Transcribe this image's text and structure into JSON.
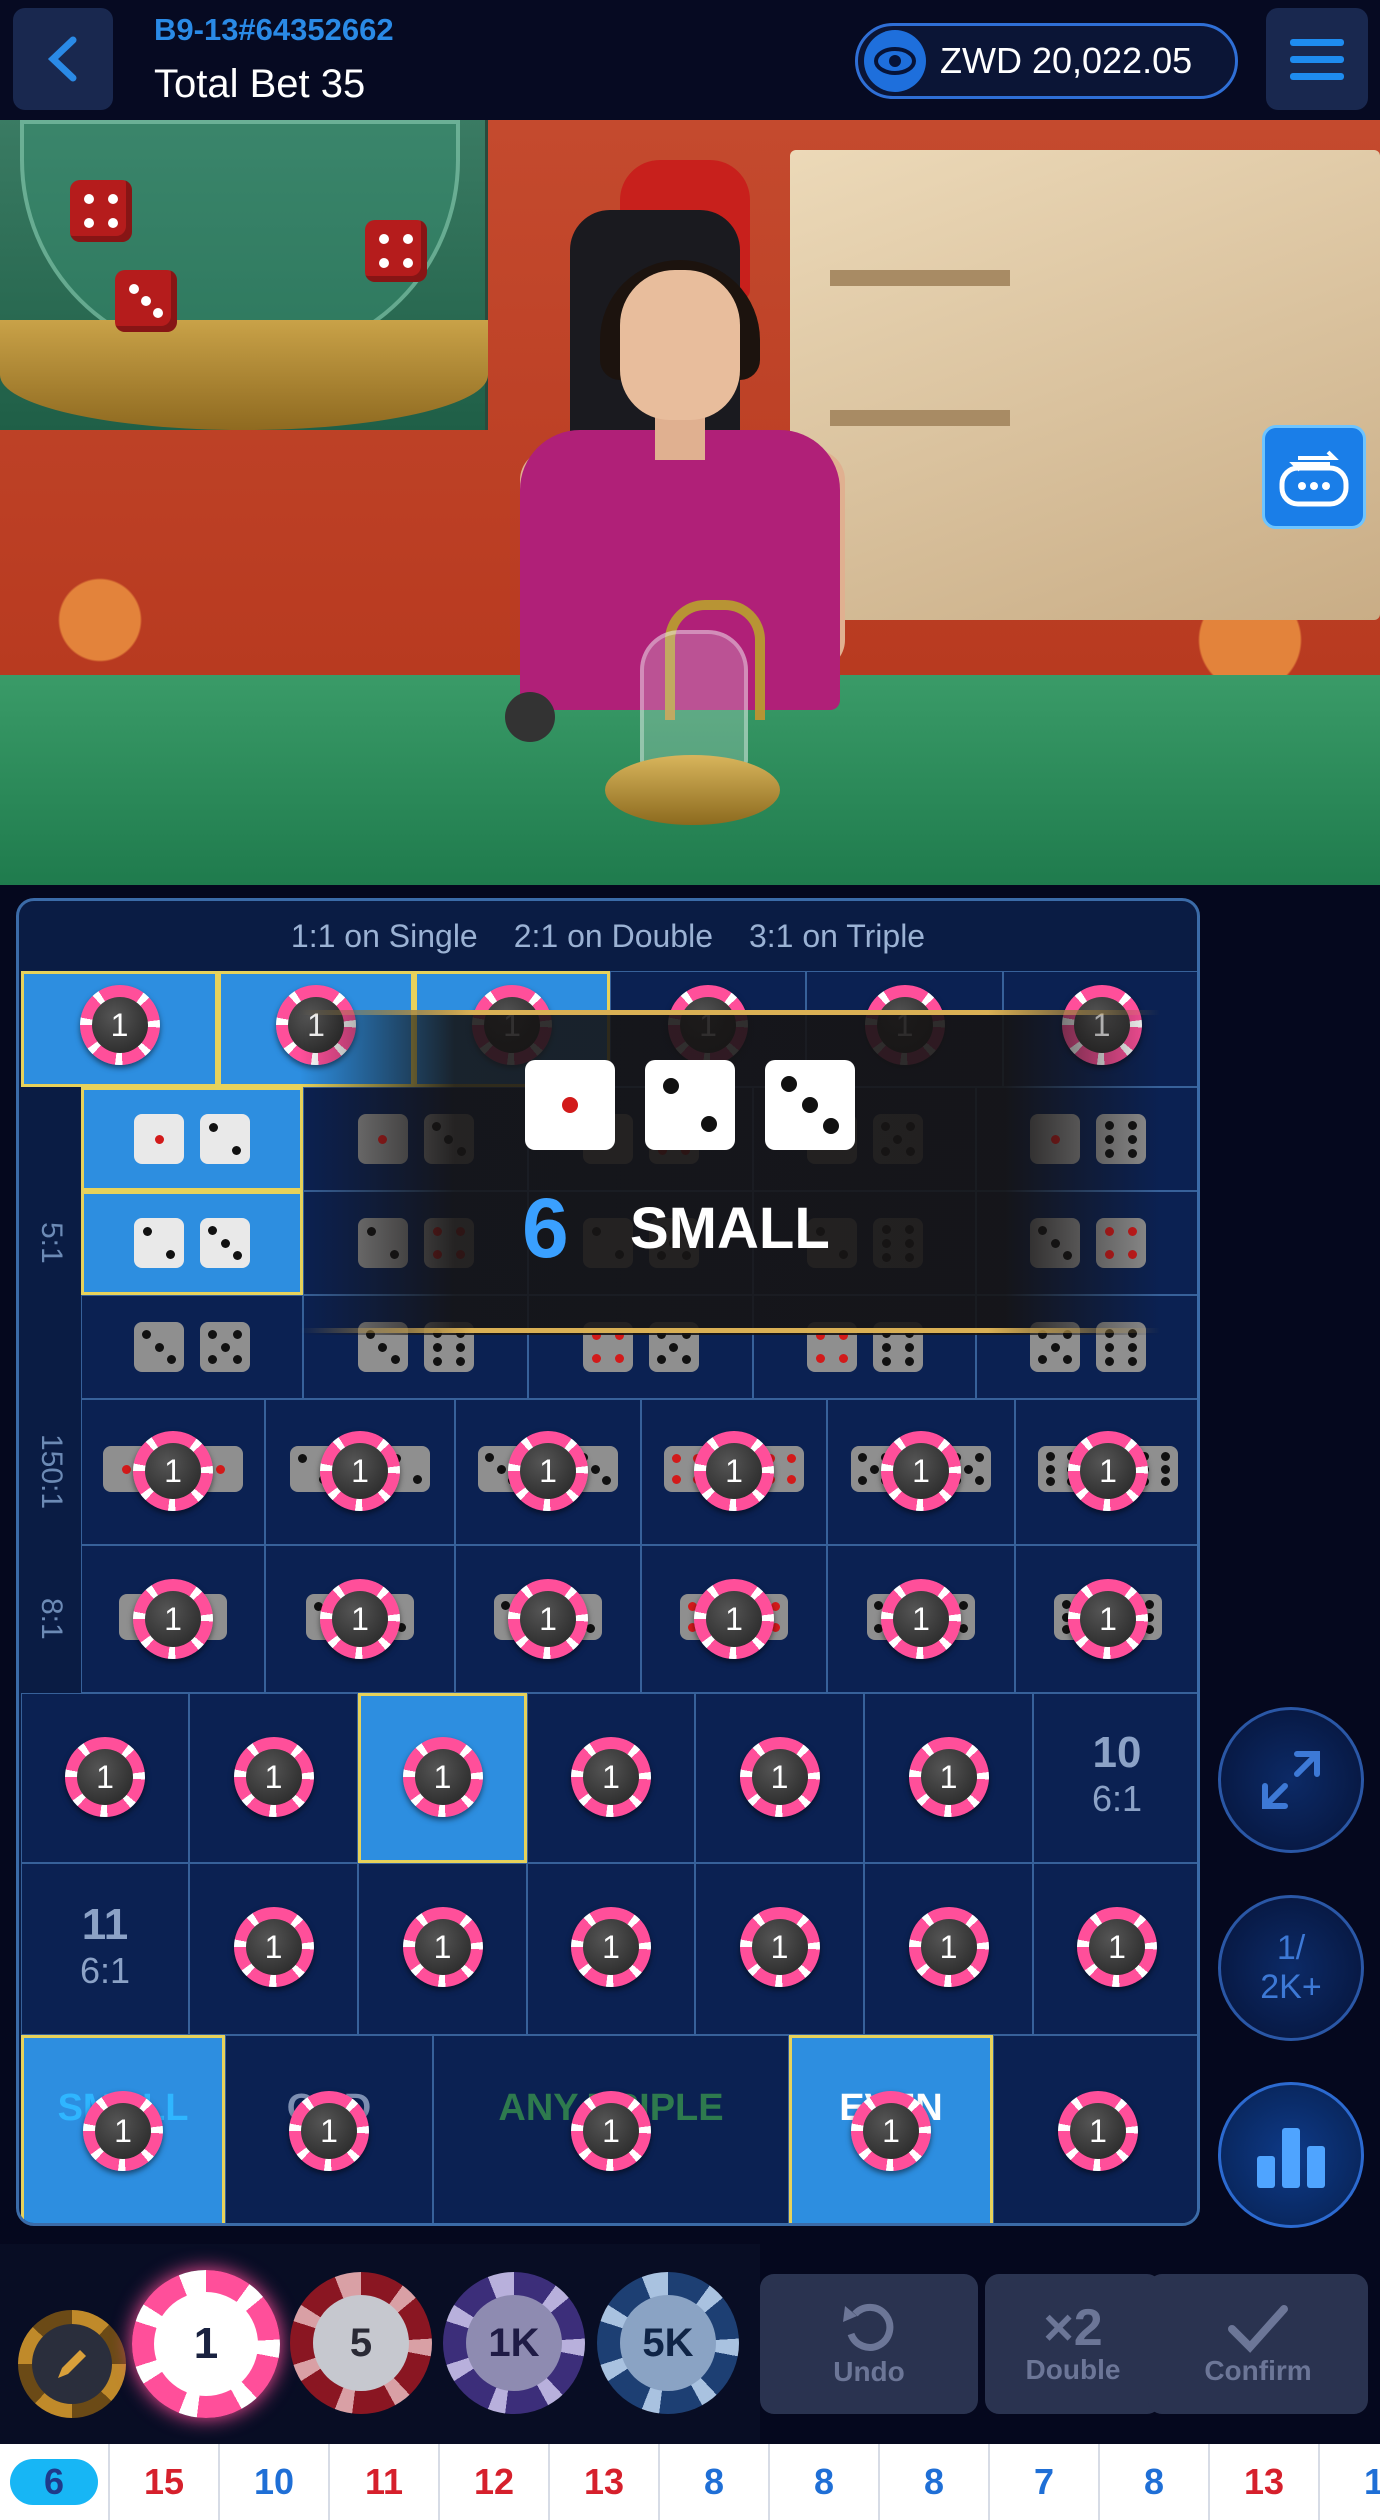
{
  "header": {
    "table_id": "B9-13#64352662",
    "total_bet": "Total Bet 35",
    "balance": "ZWD 20,022.05"
  },
  "board": {
    "payout_single": "1:1 on Single",
    "payout_double": "2:1 on Double",
    "payout_triple": "3:1 on Triple",
    "row_labels": [
      "5:1",
      "150:1",
      "8:1"
    ],
    "chip_value": "1",
    "total_10": "10",
    "total_10_odds": "6:1",
    "total_11": "11",
    "total_11_odds": "6:1",
    "small": "SMALL",
    "odd": "ODD",
    "any_triple": "ANY TRIPLE",
    "even": "EVEN"
  },
  "result": {
    "dice": [
      1,
      2,
      3
    ],
    "total": "6",
    "label": "SMALL"
  },
  "side": {
    "limit": "1/\n2K+"
  },
  "tray": {
    "chips": [
      "1",
      "5",
      "1K",
      "5K"
    ],
    "undo": "Undo",
    "double": "Double",
    "double_icon": "×2",
    "confirm": "Confirm"
  },
  "roadmap": [
    {
      "v": "6",
      "c": "blue"
    },
    {
      "v": "15",
      "c": "red"
    },
    {
      "v": "10",
      "c": "blue"
    },
    {
      "v": "11",
      "c": "red"
    },
    {
      "v": "12",
      "c": "red"
    },
    {
      "v": "13",
      "c": "red"
    },
    {
      "v": "8",
      "c": "blue"
    },
    {
      "v": "8",
      "c": "blue"
    },
    {
      "v": "8",
      "c": "blue"
    },
    {
      "v": "7",
      "c": "blue"
    },
    {
      "v": "8",
      "c": "blue"
    },
    {
      "v": "13",
      "c": "red"
    },
    {
      "v": "1",
      "c": "blue"
    }
  ],
  "colors": {
    "accent": "#2d8ee0",
    "chip": "#ff4f9a",
    "highlight": "#e7d25b"
  }
}
